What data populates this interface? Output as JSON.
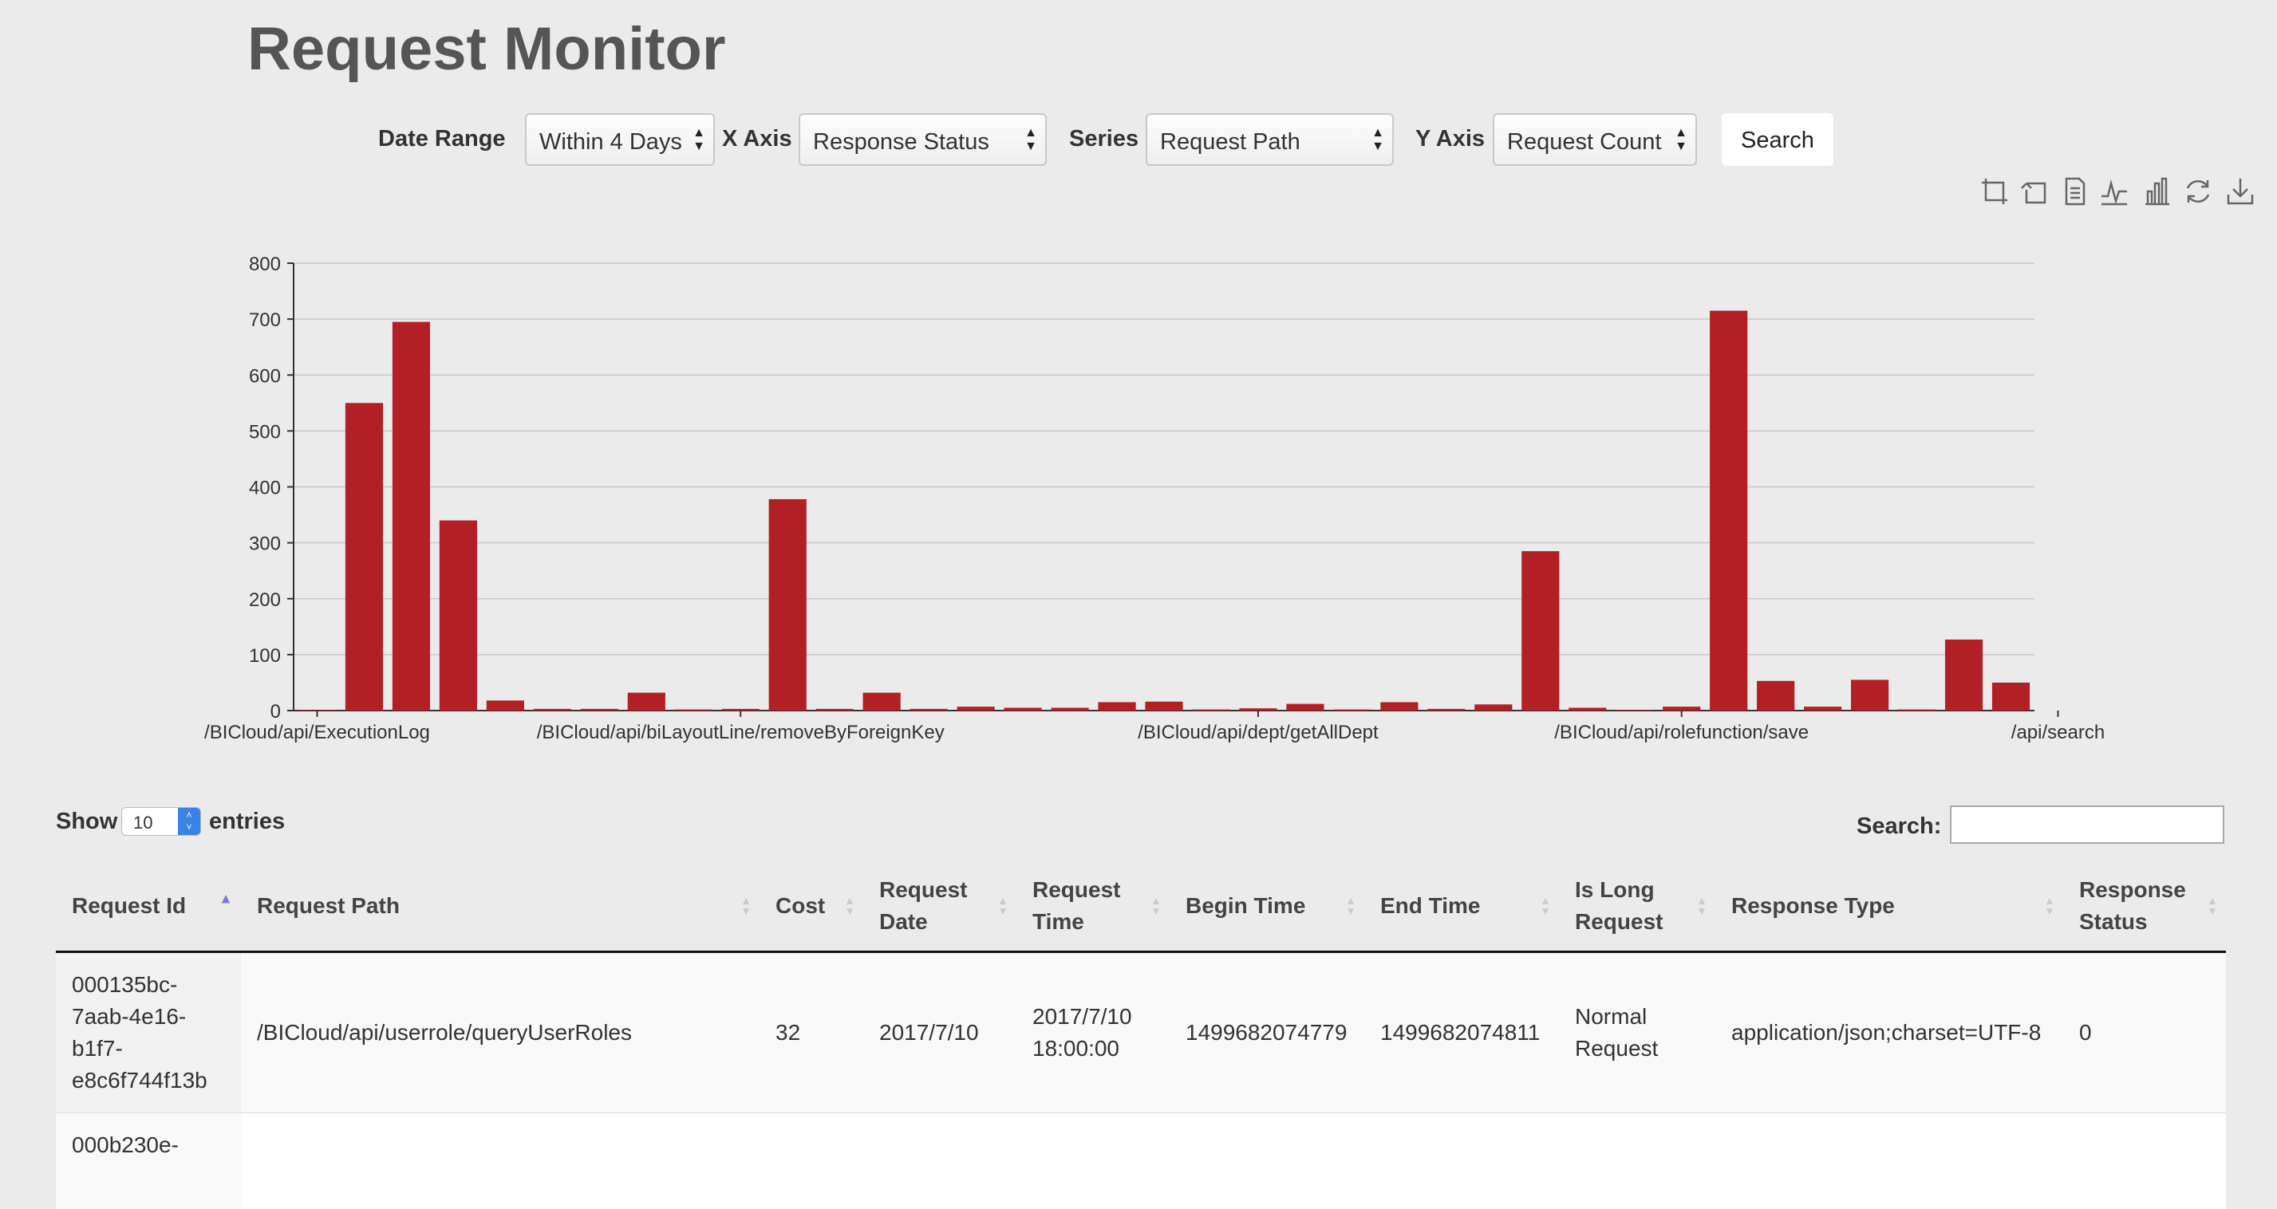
{
  "title": "Request Monitor",
  "filters": {
    "date_range_label": "Date Range",
    "date_range_value": "Within 4 Days",
    "x_axis_label": "X Axis",
    "x_axis_value": "Response Status",
    "series_label": "Series",
    "series_value": "Request Path",
    "y_axis_label": "Y Axis",
    "y_axis_value": "Request Count",
    "search_button": "Search"
  },
  "toolbox": [
    "zoom-icon",
    "zoom-reset-icon",
    "data-view-icon",
    "line-chart-icon",
    "bar-chart-icon",
    "restore-icon",
    "save-image-icon"
  ],
  "chart_data": {
    "type": "bar",
    "color": "#b22026",
    "ylim": [
      0,
      800
    ],
    "yticks": [
      0,
      100,
      200,
      300,
      400,
      500,
      600,
      700,
      800
    ],
    "x_labels": [
      {
        "index": 0,
        "text": "/BICloud/api/ExecutionLog"
      },
      {
        "index": 9,
        "text": "/BICloud/api/biLayoutLine/removeByForeignKey"
      },
      {
        "index": 20,
        "text": "/BICloud/api/dept/getAllDept"
      },
      {
        "index": 29,
        "text": "/BICloud/api/rolefunction/save"
      },
      {
        "index": 37,
        "text": "/api/search"
      }
    ],
    "values": [
      1,
      550,
      695,
      340,
      18,
      3,
      3,
      32,
      2,
      3,
      378,
      3,
      32,
      3,
      7,
      5,
      5,
      15,
      16,
      2,
      4,
      12,
      2,
      15,
      3,
      11,
      285,
      5,
      1,
      7,
      715,
      53,
      7,
      55,
      2,
      127,
      50
    ]
  },
  "table": {
    "show_label": "Show",
    "length_value": "10",
    "entries_label": "entries",
    "search_label": "Search:",
    "columns": [
      "Request Id",
      "Request Path",
      "Cost",
      "Request Date",
      "Request Time",
      "Begin Time",
      "End Time",
      "Is Long Request",
      "Response Type",
      "Response Status"
    ],
    "rows": [
      {
        "request_id": "000135bc-7aab-4e16-b1f7-e8c6f744f13b",
        "request_path": "/BICloud/api/userrole/queryUserRoles",
        "cost": "32",
        "request_date": "2017/7/10",
        "request_time": "2017/7/10 18:00:00",
        "begin_time": "1499682074779",
        "end_time": "1499682074811",
        "is_long_request": "Normal Request",
        "response_type": "application/json;charset=UTF-8",
        "response_status": "0"
      },
      {
        "request_id": "000b230e-"
      }
    ]
  }
}
